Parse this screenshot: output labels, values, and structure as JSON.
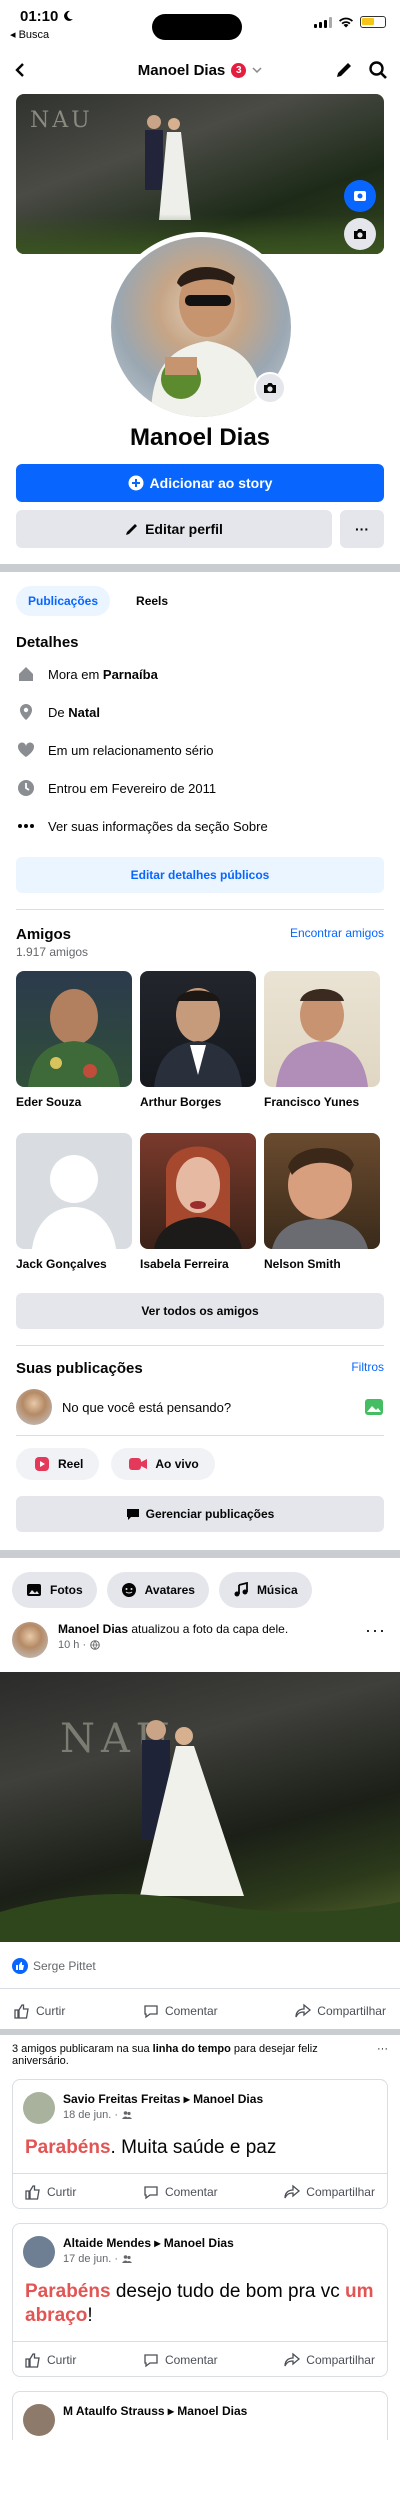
{
  "status_bar": {
    "time": "01:10",
    "back_label": "◂ Busca"
  },
  "header": {
    "title": "Manoel Dias",
    "badge_count": "3"
  },
  "profile": {
    "name": "Manoel Dias",
    "add_story_label": "Adicionar ao story",
    "edit_profile_label": "Editar perfil",
    "more_label": "···",
    "cover_letters": "NAU"
  },
  "tabs": [
    {
      "label": "Publicações"
    },
    {
      "label": "Reels"
    }
  ],
  "details": {
    "title": "Detalhes",
    "items": [
      {
        "icon": "house-icon",
        "text_pre": "Mora em ",
        "text_bold": "Parnaíba"
      },
      {
        "icon": "location-pin-icon",
        "text_pre": "De ",
        "text_bold": "Natal"
      },
      {
        "icon": "heart-icon",
        "text_pre": "Em um relacionamento sério",
        "text_bold": ""
      },
      {
        "icon": "clock-icon",
        "text_pre": "Entrou em Fevereiro de 2011",
        "text_bold": ""
      },
      {
        "icon": "ellipsis-icon",
        "text_pre": "Ver suas informações da seção Sobre",
        "text_bold": ""
      }
    ],
    "edit_button": "Editar detalhes públicos"
  },
  "friends": {
    "title": "Amigos",
    "count": "1.917 amigos",
    "find_link": "Encontrar amigos",
    "items": [
      {
        "name": "Eder Souza"
      },
      {
        "name": "Arthur Borges"
      },
      {
        "name": "Francisco Yunes"
      },
      {
        "name": "Jack Gonçalves"
      },
      {
        "name": "Isabela Ferreira"
      },
      {
        "name": "Nelson Smith"
      }
    ],
    "see_all": "Ver todos os amigos"
  },
  "posts_section": {
    "title": "Suas publicações",
    "filters": "Filtros",
    "composer_placeholder": "No que você está pensando?",
    "reel_label": "Reel",
    "live_label": "Ao vivo",
    "manage_label": "Gerenciar publicações"
  },
  "chips": [
    {
      "label": "Fotos"
    },
    {
      "label": "Avatares"
    },
    {
      "label": "Música"
    }
  ],
  "post": {
    "author": "Manoel Dias",
    "action": " atualizou a foto da capa dele.",
    "time": "10 h ·",
    "photo_letters": "NAU",
    "reaction_name": "Serge Pittet",
    "like": "Curtir",
    "comment": "Comentar",
    "share": "Compartilhar"
  },
  "timeline": {
    "note_pre": "3 amigos publicaram na sua ",
    "note_bold": "linha do tempo",
    "note_post": " para desejar feliz aniversário.",
    "wishes": [
      {
        "from": "Savio Freitas Freitas",
        "to": "Manoel Dias",
        "date": "18 de jun. ·",
        "red1": "Parabéns",
        "text1": ". Muita saúde e paz",
        "red2": "",
        "text2": "",
        "avatar_color": "#a8b29c"
      },
      {
        "from": "Altaide Mendes",
        "to": "Manoel Dias",
        "date": "17 de jun. ·",
        "red1": "Parabéns",
        "text1": " desejo tudo de bom pra vc ",
        "red2": "um abraço",
        "text2": "!",
        "avatar_color": "#6f7f93"
      },
      {
        "from": "M Ataulfo Strauss",
        "to": "Manoel Dias",
        "date": "",
        "red1": "",
        "text1": "",
        "red2": "",
        "text2": "",
        "avatar_color": "#8d7a6a"
      }
    ]
  },
  "colors": {
    "brand_blue": "#0866ff",
    "badge_red": "#e41e3f",
    "wish_red": "#e25555"
  }
}
